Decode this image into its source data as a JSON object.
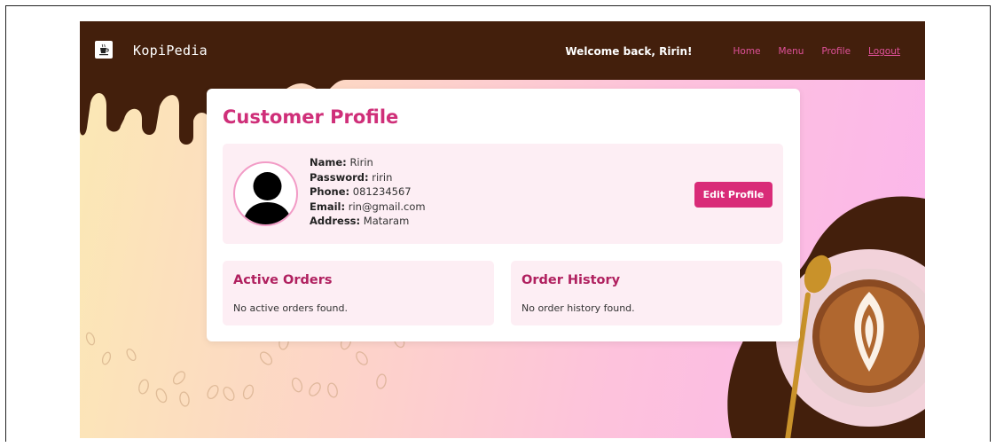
{
  "navbar": {
    "brand": "KopiPedia",
    "logo_icon": "coffee-cup-icon",
    "welcome": "Welcome back, Ririn!",
    "links": [
      "Home",
      "Menu",
      "Profile",
      "Logout"
    ]
  },
  "profile": {
    "title": "Customer Profile",
    "avatar_icon": "user-avatar-icon",
    "fields": [
      {
        "label": "Name:",
        "value": "Ririn"
      },
      {
        "label": "Password:",
        "value": "ririn"
      },
      {
        "label": "Phone:",
        "value": "081234567"
      },
      {
        "label": "Email:",
        "value": "rin@gmail.com"
      },
      {
        "label": "Address:",
        "value": "Mataram"
      }
    ],
    "edit_button": "Edit Profile"
  },
  "active_orders": {
    "title": "Active Orders",
    "message": "No active orders found."
  },
  "order_history": {
    "title": "Order History",
    "message": "No order history found."
  },
  "colors": {
    "navbar": "#431f0c",
    "accent": "#d92b78",
    "link": "#e0519a",
    "panel_bg": "#fdeef4"
  }
}
